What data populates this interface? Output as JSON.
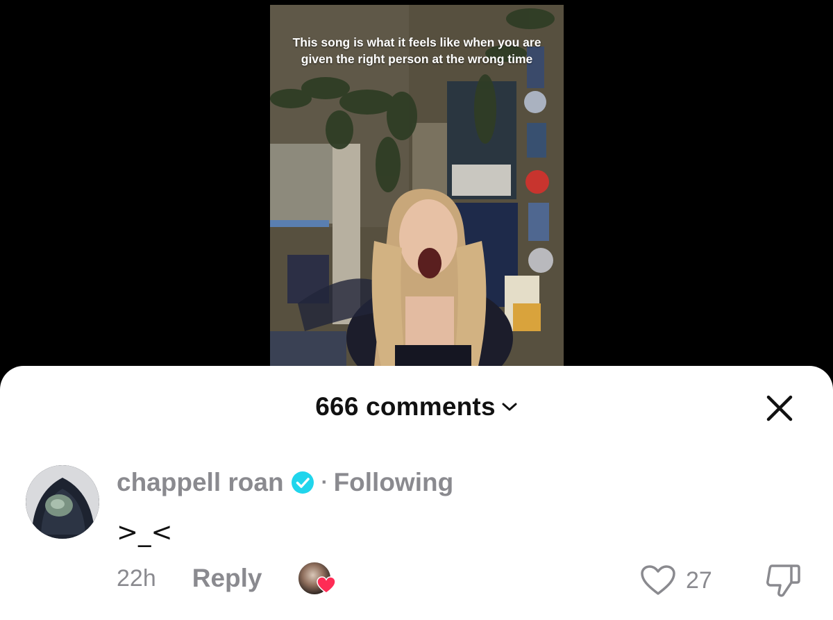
{
  "video": {
    "caption": "This song is what it feels like when you are given the right person at the wrong time"
  },
  "comments_sheet": {
    "count_label": "666 comments",
    "sort_icon": "chevron-down-icon",
    "close_icon": "close-icon"
  },
  "comment": {
    "author": "chappell roan",
    "verified_icon": "verified-badge-icon",
    "separator": "·",
    "follow_status": "Following",
    "text": ">_<",
    "time": "22h",
    "reply_label": "Reply",
    "like_count": "27",
    "like_icon": "heart-outline-icon",
    "dislike_icon": "thumbs-down-icon",
    "creator_liked_icon": "creator-liked-heart-icon"
  },
  "colors": {
    "verified": "#20D5EC",
    "liked_heart": "#FE2C55",
    "muted_text": "#8A8A8F",
    "primary_text": "#111111"
  }
}
